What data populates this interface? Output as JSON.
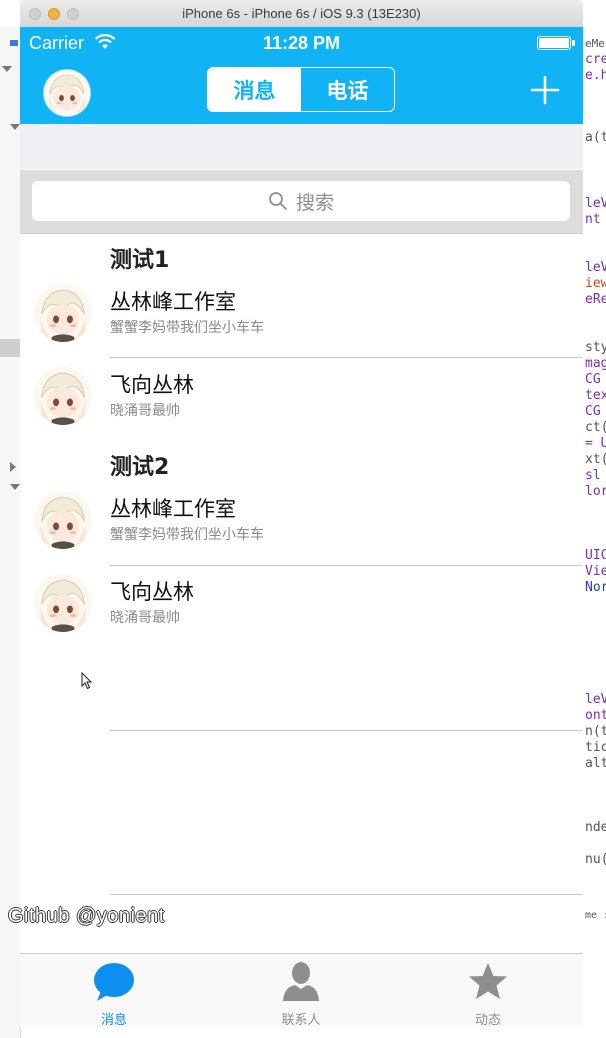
{
  "window": {
    "title": "iPhone 6s - iPhone 6s / iOS 9.3 (13E230)"
  },
  "status_bar": {
    "carrier": "Carrier",
    "time": "11:28 PM"
  },
  "nav": {
    "segments": [
      {
        "label": "消息",
        "active": true
      },
      {
        "label": "电话",
        "active": false
      }
    ],
    "accent_color": "#10b4f5"
  },
  "search": {
    "placeholder": "搜索"
  },
  "sections": [
    {
      "header": "测试1",
      "rows": [
        {
          "title": "丛林峰工作室",
          "subtitle": "蟹蟹李妈带我们坐小车车"
        },
        {
          "title": "飞向丛林",
          "subtitle": "晓涌哥最帅"
        }
      ]
    },
    {
      "header": "测试2",
      "rows": [
        {
          "title": "丛林峰工作室",
          "subtitle": "蟹蟹李妈带我们坐小车车"
        },
        {
          "title": "飞向丛林",
          "subtitle": "晓涌哥最帅"
        }
      ]
    }
  ],
  "watermark": "Github @yonient",
  "tabbar": {
    "items": [
      {
        "label": "消息",
        "icon": "chat-bubble-icon",
        "active": true
      },
      {
        "label": "联系人",
        "icon": "person-icon",
        "active": false
      },
      {
        "label": "动态",
        "icon": "star-icon",
        "active": false
      }
    ],
    "active_color": "#0d8ff0",
    "inactive_color": "#8e8e8e"
  }
}
